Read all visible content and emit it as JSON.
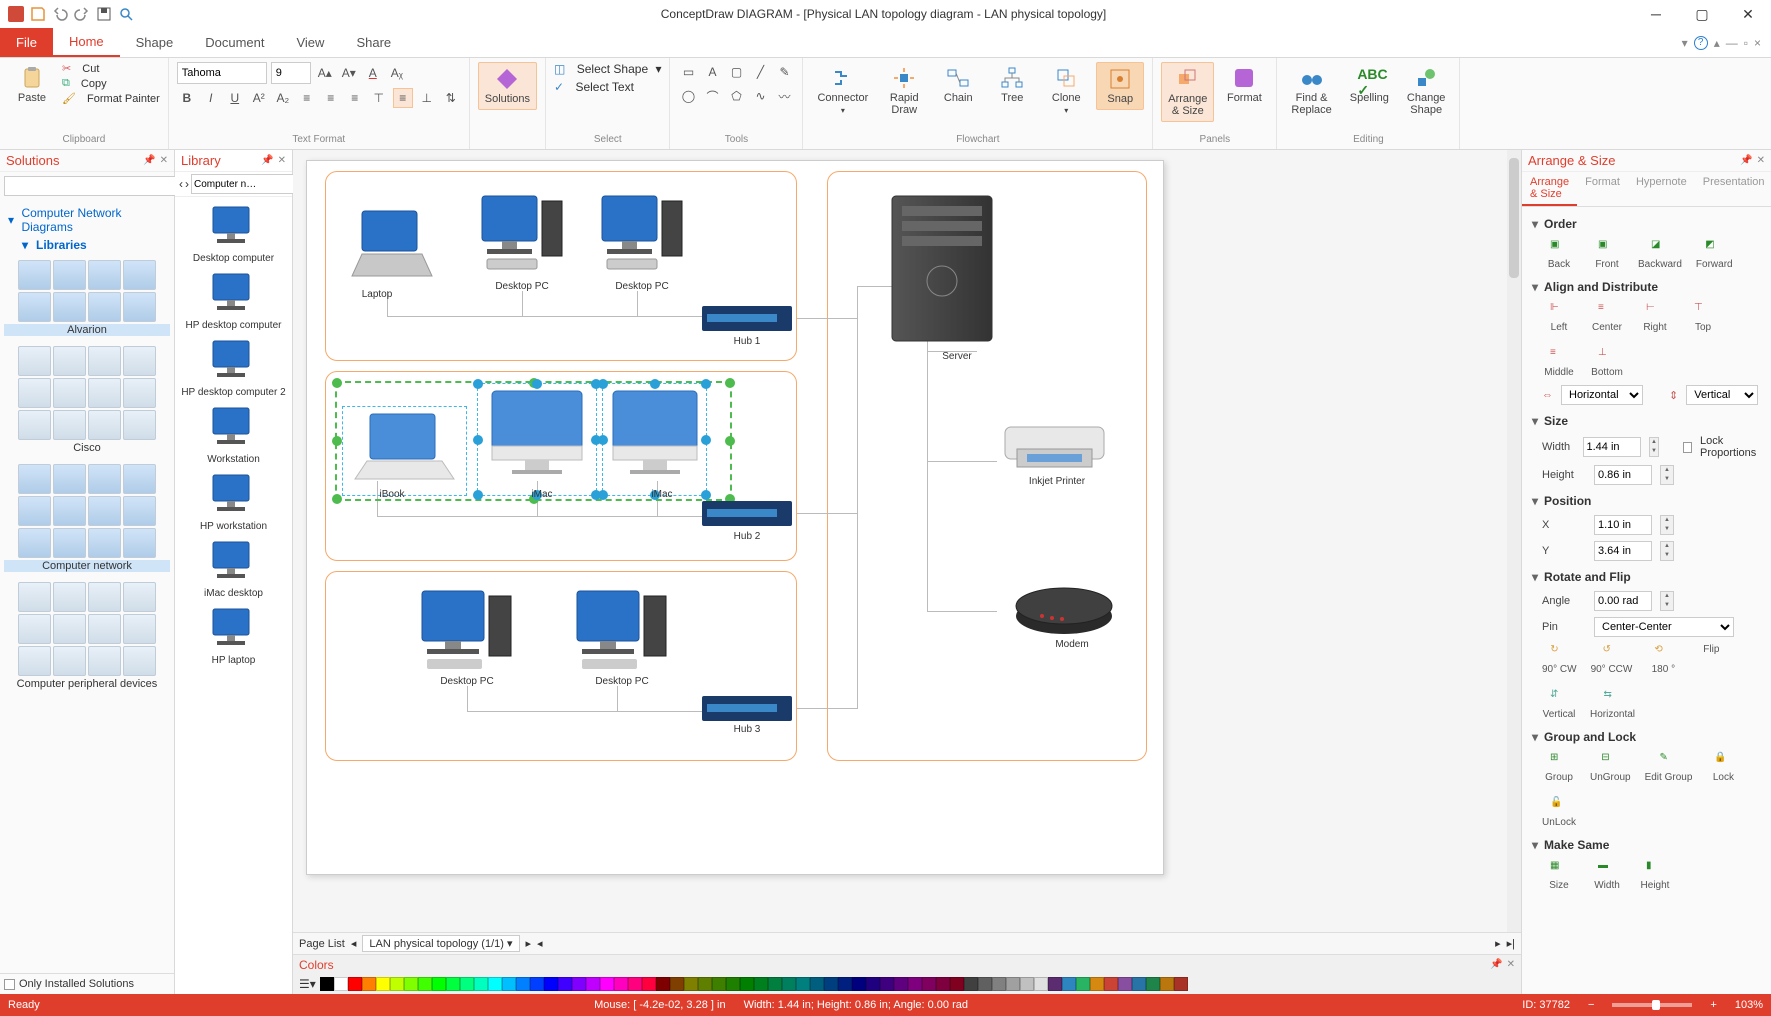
{
  "app": {
    "title": "ConceptDraw DIAGRAM - [Physical LAN topology diagram - LAN physical topology]"
  },
  "menu": {
    "file": "File",
    "tabs": [
      "Home",
      "Shape",
      "Document",
      "View",
      "Share"
    ],
    "active_index": 0
  },
  "ribbon": {
    "clipboard": {
      "paste": "Paste",
      "cut": "Cut",
      "copy": "Copy",
      "format_painter": "Format Painter",
      "group_label": "Clipboard"
    },
    "text_format": {
      "font": "Tahoma",
      "size": "9",
      "group_label": "Text Format"
    },
    "solutions": {
      "label": "Solutions"
    },
    "select": {
      "select_shape": "Select Shape",
      "select_text": "Select Text",
      "group_label": "Select"
    },
    "tools": {
      "group_label": "Tools"
    },
    "flowchart": {
      "connector": "Connector",
      "rapid_draw": "Rapid\nDraw",
      "chain": "Chain",
      "tree": "Tree",
      "clone": "Clone",
      "snap": "Snap",
      "group_label": "Flowchart"
    },
    "panels": {
      "arrange": "Arrange\n& Size",
      "format": "Format",
      "group_label": "Panels"
    },
    "editing": {
      "find_replace": "Find &\nReplace",
      "spelling": "Spelling",
      "change_shape": "Change\nShape",
      "group_label": "Editing"
    }
  },
  "solutions_panel": {
    "header": "Solutions",
    "tree": {
      "root": "Computer Network Diagrams",
      "child": "Libraries"
    },
    "sets": [
      {
        "label": "Alvarion",
        "count": 8
      },
      {
        "label": "Cisco",
        "count": 12
      },
      {
        "label": "Computer network",
        "count": 12
      },
      {
        "label": "Computer peripheral devices",
        "count": 12
      }
    ],
    "footer_checkbox": "Only Installed Solutions"
  },
  "library_panel": {
    "header": "Library",
    "dropdown": "Computer n…",
    "items": [
      "Desktop computer",
      "HP desktop computer",
      "HP desktop computer 2",
      "Workstation",
      "HP workstation",
      "iMac desktop",
      "HP laptop"
    ]
  },
  "canvas": {
    "devices": {
      "laptop": "Laptop",
      "desktop_pc": "Desktop PC",
      "hub1": "Hub 1",
      "ibook": "iBook",
      "imac": "iMac",
      "hub2": "Hub 2",
      "hub3": "Hub 3",
      "server": "Server",
      "printer": "Inkjet Printer",
      "modem": "Modem"
    }
  },
  "pagelist": {
    "label": "Page List",
    "tab": "LAN physical topology (1/1)"
  },
  "colors_panel": {
    "header": "Colors"
  },
  "arrange_panel": {
    "header": "Arrange & Size",
    "tabs": [
      "Arrange & Size",
      "Format",
      "Hypernote",
      "Presentation"
    ],
    "sections": {
      "order": {
        "title": "Order",
        "actions": [
          "Back",
          "Front",
          "Backward",
          "Forward"
        ]
      },
      "align": {
        "title": "Align and Distribute",
        "actions": [
          "Left",
          "Center",
          "Right",
          "Top",
          "Middle",
          "Bottom"
        ],
        "horiz_label": "Horizontal",
        "vert_label": "Vertical"
      },
      "size": {
        "title": "Size",
        "width_label": "Width",
        "width_value": "1.44 in",
        "height_label": "Height",
        "height_value": "0.86 in",
        "lock": "Lock Proportions"
      },
      "position": {
        "title": "Position",
        "x_label": "X",
        "x_value": "1.10 in",
        "y_label": "Y",
        "y_value": "3.64 in"
      },
      "rotate": {
        "title": "Rotate and Flip",
        "angle_label": "Angle",
        "angle_value": "0.00 rad",
        "pin_label": "Pin",
        "pin_value": "Center-Center",
        "actions": [
          "90° CW",
          "90° CCW",
          "180 °",
          "Flip",
          "Vertical",
          "Horizontal"
        ]
      },
      "group": {
        "title": "Group and Lock",
        "actions": [
          "Group",
          "UnGroup",
          "Edit Group",
          "Lock",
          "UnLock"
        ]
      },
      "makesame": {
        "title": "Make Same",
        "actions": [
          "Size",
          "Width",
          "Height"
        ]
      }
    }
  },
  "statusbar": {
    "ready": "Ready",
    "mouse": "Mouse: [ -4.2e-02, 3.28 ] in",
    "dims": "Width: 1.44 in;  Height: 0.86 in;  Angle: 0.00 rad",
    "id": "ID: 37782",
    "zoom": "103%"
  },
  "color_swatches": [
    "#000000",
    "#ffffff",
    "#ff0000",
    "#ff7f00",
    "#ffff00",
    "#bfff00",
    "#7fff00",
    "#3fff00",
    "#00ff00",
    "#00ff3f",
    "#00ff7f",
    "#00ffbf",
    "#00ffff",
    "#00bfff",
    "#007fff",
    "#003fff",
    "#0000ff",
    "#3f00ff",
    "#7f00ff",
    "#bf00ff",
    "#ff00ff",
    "#ff00bf",
    "#ff007f",
    "#ff003f",
    "#7f0000",
    "#7f3f00",
    "#7f7f00",
    "#5f7f00",
    "#3f7f00",
    "#1f7f00",
    "#007f00",
    "#007f1f",
    "#007f3f",
    "#007f5f",
    "#007f7f",
    "#005f7f",
    "#003f7f",
    "#001f7f",
    "#00007f",
    "#1f007f",
    "#3f007f",
    "#5f007f",
    "#7f007f",
    "#7f005f",
    "#7f003f",
    "#7f001f",
    "#404040",
    "#606060",
    "#808080",
    "#a0a0a0",
    "#c0c0c0",
    "#e0e0e0",
    "#5b2c6f",
    "#2e86c1",
    "#28b463",
    "#d68910",
    "#cb4335",
    "#884ea0",
    "#2874a6",
    "#1e8449",
    "#b9770e",
    "#a93226"
  ]
}
